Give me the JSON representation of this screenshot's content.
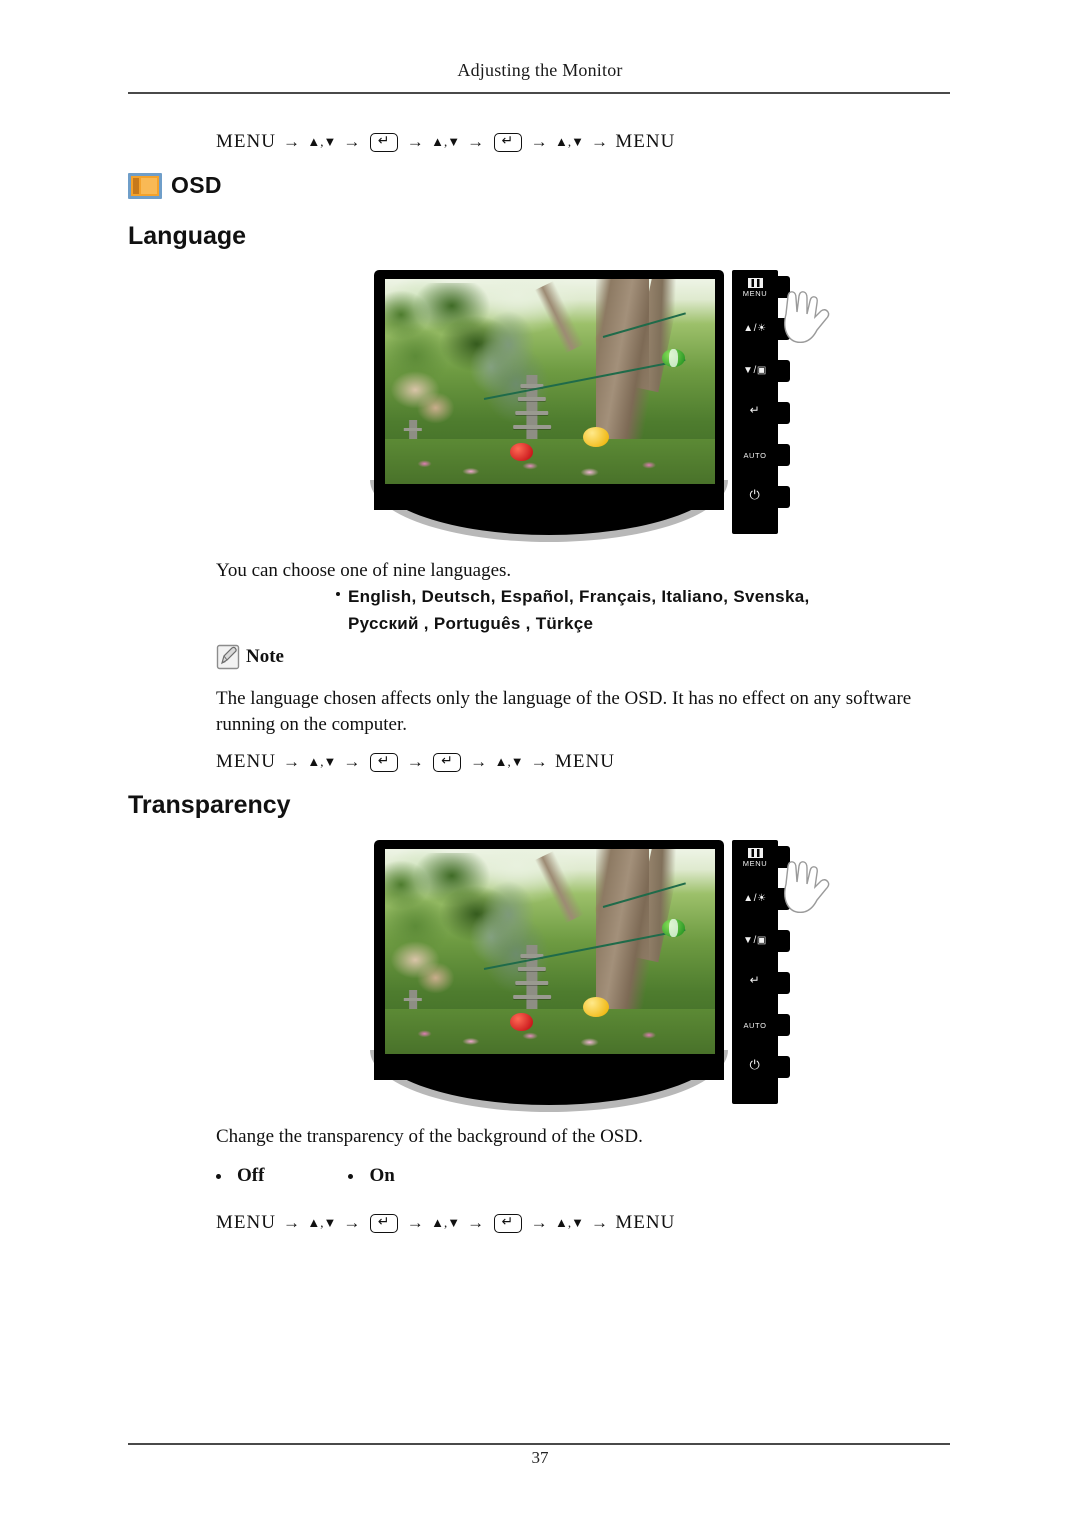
{
  "page": {
    "header_title": "Adjusting the Monitor",
    "page_number": "37"
  },
  "osd_section": {
    "icon": "osd-icon",
    "label": "OSD"
  },
  "language_section": {
    "title": "Language",
    "top_nav_path": {
      "start": "MENU",
      "end": "MENU",
      "arrow": "→",
      "up": "▲",
      "down": "▼",
      "comma": ",",
      "enter_key": "↵"
    },
    "description": "You can choose one of nine languages.",
    "languages_line_1": "English, Deutsch, Español, Français,  Italiano, Svenska,",
    "languages_line_2": "Русский , Português , Türkçe",
    "note_label": "Note",
    "note_text": "The language chosen affects only the language of the OSD. It has no effect on any software running on the computer.",
    "bottom_nav_path": {
      "start": "MENU",
      "end": "MENU",
      "arrow": "→",
      "up": "▲",
      "down": "▼",
      "comma": ",",
      "enter_key": "↵"
    }
  },
  "transparency_section": {
    "title": "Transparency",
    "description": "Change the transparency of the background of the OSD.",
    "options": [
      "Off",
      "On"
    ],
    "nav_path": {
      "start": "MENU",
      "end": "MENU",
      "arrow": "→",
      "up": "▲",
      "down": "▼",
      "comma": ",",
      "enter_key": "↵"
    }
  },
  "monitor_illustration": {
    "panel_buttons": [
      {
        "icon": "menu-bars-icon",
        "label": "MENU"
      },
      {
        "icon": "brightness-up-icon",
        "label": "▲/☀"
      },
      {
        "icon": "down-source-icon",
        "label": "▼/▣"
      },
      {
        "icon": "enter-icon",
        "label": "↵"
      },
      {
        "icon": "auto-icon",
        "label": "AUTO"
      },
      {
        "icon": "power-icon",
        "label": "⏻"
      }
    ],
    "hand_cursor": "hand-pointer-icon"
  },
  "colors": {
    "osd_icon_border": "#6f9ec9",
    "osd_icon_fill": "#f4a22b",
    "text": "#111111",
    "rule": "#4a4a4a"
  }
}
